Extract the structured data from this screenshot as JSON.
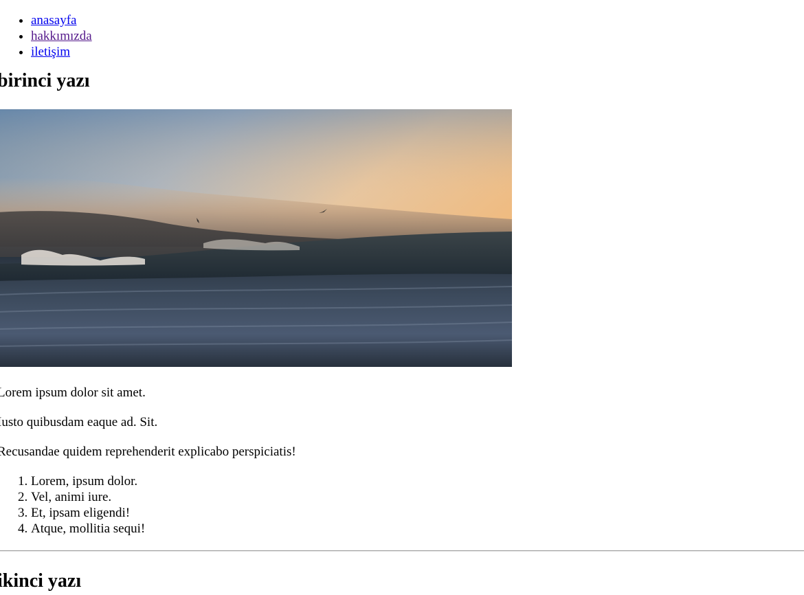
{
  "nav": {
    "items": [
      {
        "label": "anasayfa"
      },
      {
        "label": "hakkımızda"
      },
      {
        "label": "iletişim"
      }
    ]
  },
  "post1": {
    "title": "birinci yazı",
    "image_description_icon": "sunset-ocean-wave-photo",
    "paragraphs": [
      "Lorem ipsum dolor sit amet.",
      "Iusto quibusdam eaque ad. Sit.",
      "Recusandae quidem reprehenderit explicabo perspiciatis!"
    ],
    "list": [
      "Lorem, ipsum dolor.",
      "Vel, animi iure.",
      "Et, ipsam eligendi!",
      "Atque, mollitia sequi!"
    ]
  },
  "post2": {
    "title": "ikinci yazı"
  },
  "colors": {
    "link": "#0000ee",
    "visited_link": "#551a8b",
    "divider": "#9a9a9a"
  }
}
